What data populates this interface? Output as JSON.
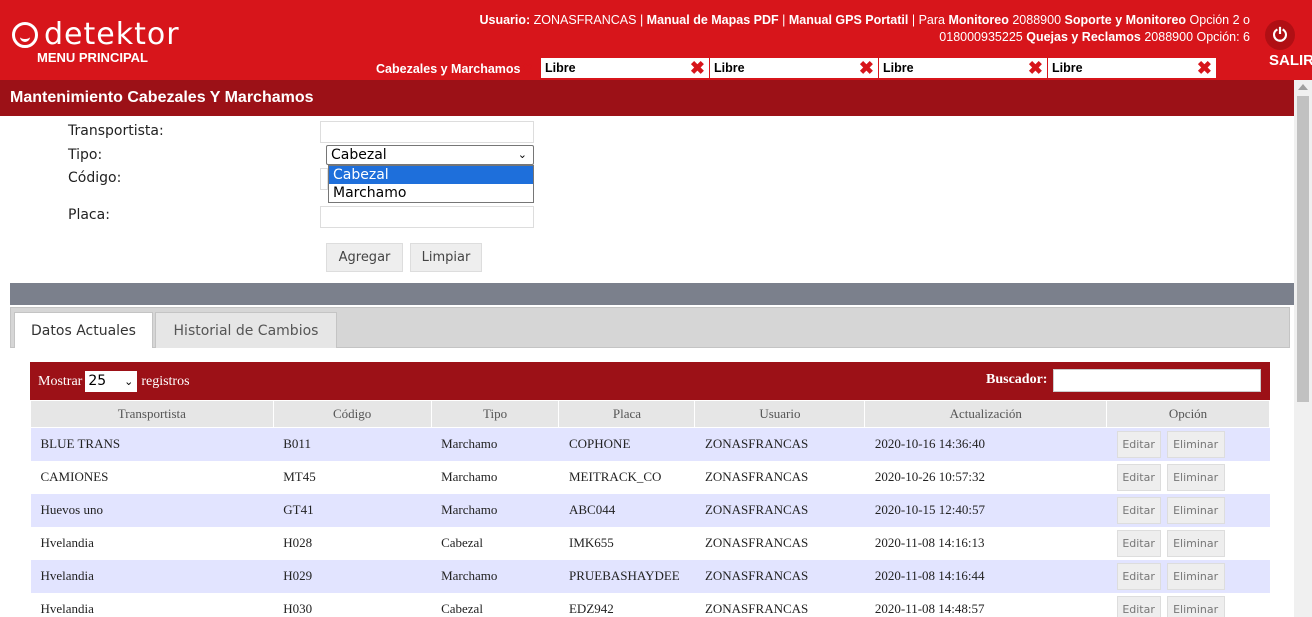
{
  "header": {
    "logo_text": "detektor",
    "menu_principal": "MENU PRINCIPAL",
    "user_label": "Usuario:",
    "user_value": "ZONASFRANCAS",
    "sep": "|",
    "manual_mapas": "Manual de Mapas PDF",
    "manual_gps": "Manual GPS Portatil",
    "para_monitoreo": "Para",
    "monitoreo_label": "Monitoreo",
    "monitoreo_num": "2088900",
    "soporte_label": "Soporte y Monitoreo",
    "soporte_opt": "Opción 2 o",
    "line2_num": "018000935225",
    "quejas_label": "Quejas y Reclamos",
    "quejas_num": "2088900 Opción: 6",
    "power_icon": "⏻",
    "salir": "SALIR"
  },
  "tabs": {
    "active": "Cabezales y Marchamos",
    "close_glyph": "✖",
    "free": [
      "Libre",
      "Libre",
      "Libre",
      "Libre"
    ]
  },
  "title": "Mantenimiento Cabezales Y Marchamos",
  "form": {
    "transportista_label": "Transportista:",
    "tipo_label": "Tipo:",
    "codigo_label": "Código:",
    "placa_label": "Placa:",
    "tipo_selected": "Cabezal",
    "tipo_options": [
      "Cabezal",
      "Marchamo"
    ],
    "agregar": "Agregar",
    "limpiar": "Limpiar"
  },
  "panel_tabs": [
    "Datos Actuales",
    "Historial de Cambios"
  ],
  "table": {
    "mostrar": "Mostrar",
    "page_size": "25",
    "registros": "registros",
    "buscador": "Buscador:",
    "columns": [
      "Transportista",
      "Código",
      "Tipo",
      "Placa",
      "Usuario",
      "Actualización",
      "Opción"
    ],
    "edit_label": "Editar",
    "delete_label": "Eliminar",
    "rows": [
      [
        "BLUE TRANS",
        "B011",
        "Marchamo",
        "COPHONE",
        "ZONASFRANCAS",
        "2020-10-16 14:36:40"
      ],
      [
        "CAMIONES",
        "MT45",
        "Marchamo",
        "MEITRACK_CO",
        "ZONASFRANCAS",
        "2020-10-26 10:57:32"
      ],
      [
        "Huevos uno",
        "GT41",
        "Marchamo",
        "ABC044",
        "ZONASFRANCAS",
        "2020-10-15 12:40:57"
      ],
      [
        "Hvelandia",
        "H028",
        "Cabezal",
        "IMK655",
        "ZONASFRANCAS",
        "2020-11-08 14:16:13"
      ],
      [
        "Hvelandia",
        "H029",
        "Marchamo",
        "PRUEBASHAYDEE",
        "ZONASFRANCAS",
        "2020-11-08 14:16:44"
      ],
      [
        "Hvelandia",
        "H030",
        "Cabezal",
        "EDZ942",
        "ZONASFRANCAS",
        "2020-11-08 14:48:57"
      ]
    ]
  }
}
